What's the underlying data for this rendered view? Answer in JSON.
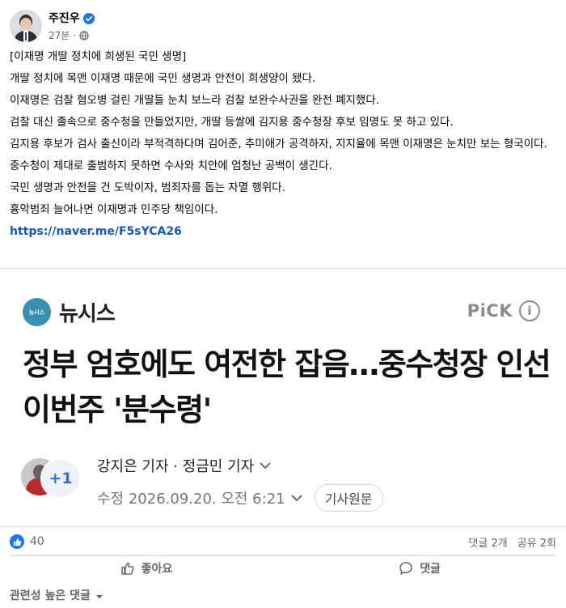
{
  "post": {
    "author": "주진우",
    "time": "27분",
    "dot": "·",
    "body": [
      "[이재명 개딸 정치에 희생된 국민 생명]",
      "개딸 정치에 목맨 이재명 때문에 국민 생명과 안전이 희생양이 됐다.",
      "이재명은 검찰 혐오병 걸린 개딸들 눈치 보느라 검찰 보완수사권을 완전 폐지했다.",
      "검찰 대신 졸속으로 중수청을 만들었지만, 개딸 등쌀에 김지용 중수청장 후보 임명도 못 하고 있다.",
      "김지용 후보가 검사 출신이라 부적격하다며 김어준, 추미애가 공격하자, 지지율에 목맨 이재명은 눈치만 보는 형국이다.",
      "중수청이 제대로 출범하지 못하면 수사와 치안에 엄청난 공백이 생긴다.",
      "국민 생명과 안전을 건 도박이자, 범죄자를 돕는 자멸 행위다.",
      "흉악범죄 늘어나면 이재명과 민주당 책임이다."
    ],
    "link": "https://naver.me/F5sYCA26"
  },
  "news_card": {
    "logo_badge": "뉴시스",
    "publisher": "뉴시스",
    "pick": "PiCK",
    "info": "i",
    "headline": "정부 엄호에도 여전한 잡음…중수청장 인선 이번주 '분수령'",
    "more_reporters": "+1",
    "reporters": "강지은 기자 · 정금민 기자",
    "date": "수정 2026.09.20. 오전 6:21",
    "original_button": "기사원문"
  },
  "stats": {
    "likes": "40",
    "comments": "댓글 2개",
    "shares": "공유 2회"
  },
  "actions": {
    "like": "좋아요",
    "comment": "댓글"
  },
  "comments_sort": "관련성 높은 댓글",
  "colors": {
    "link": "#1559b4",
    "facebook_blue": "#1877f2",
    "newsis": "#3d8fb0"
  },
  "icons": [
    "verified-icon",
    "globe-icon",
    "info-icon",
    "chevron-down-icon",
    "like-icon",
    "comment-icon",
    "caret-down-icon"
  ]
}
